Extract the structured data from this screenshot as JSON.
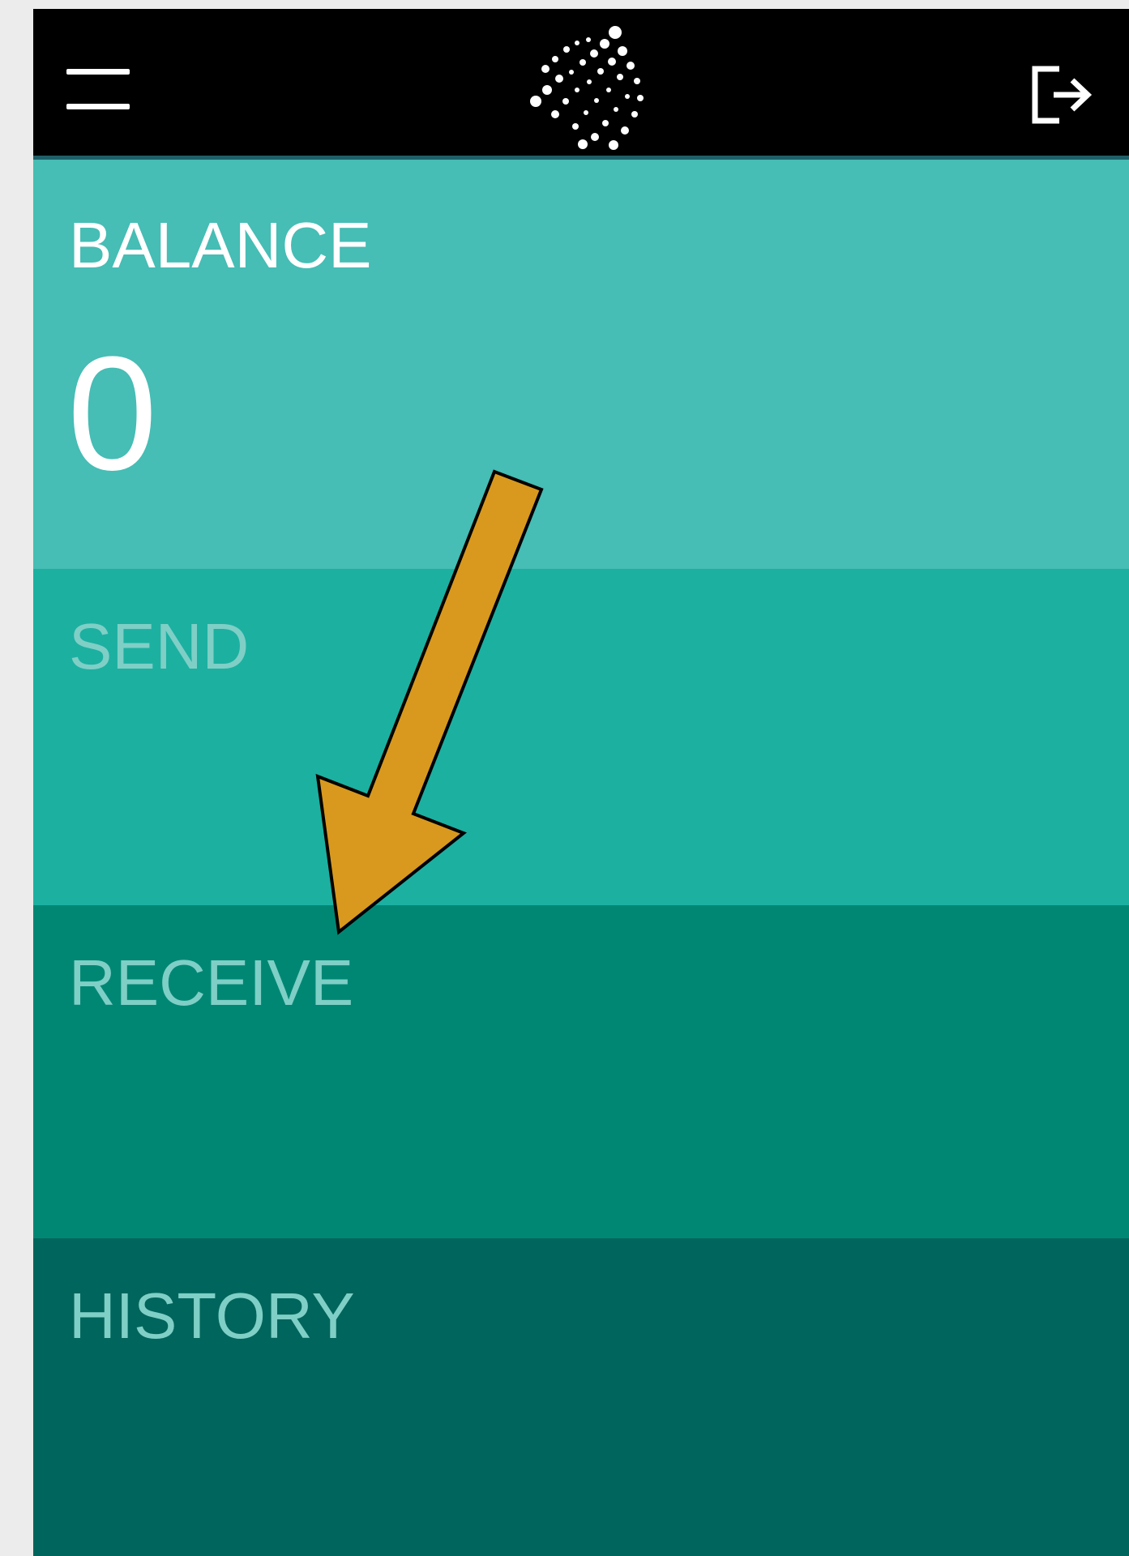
{
  "header": {
    "menu_icon": "hamburger-menu-icon",
    "logo_icon": "iota-logo-icon",
    "logout_icon": "logout-icon"
  },
  "balance": {
    "label": "BALANCE",
    "value": "0"
  },
  "send": {
    "label": "SEND"
  },
  "receive": {
    "label": "RECEIVE"
  },
  "history": {
    "label": "HISTORY"
  },
  "annotation": {
    "icon": "pointer-arrow-icon",
    "color": "#d8991e"
  },
  "colors": {
    "header": "#000000",
    "balance": "#46bdb5",
    "send": "#1cb0a1",
    "receive": "#008774",
    "history": "#00655c"
  }
}
